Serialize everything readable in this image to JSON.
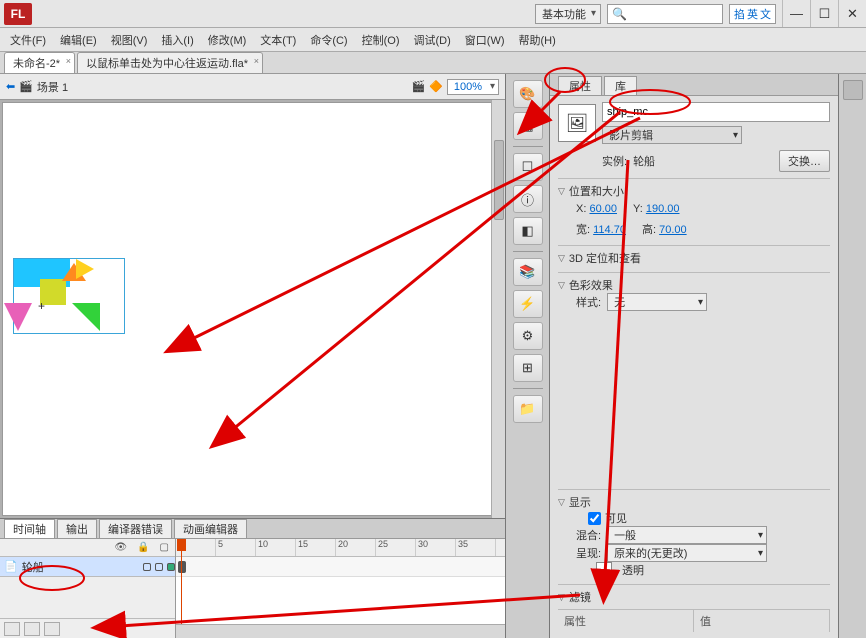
{
  "app": {
    "logo": "FL"
  },
  "workspace_combo": "基本功能",
  "ime": {
    "a": "掐",
    "b": "英",
    "c": "文"
  },
  "menus": [
    "文件(F)",
    "编辑(E)",
    "视图(V)",
    "插入(I)",
    "修改(M)",
    "文本(T)",
    "命令(C)",
    "控制(O)",
    "调试(D)",
    "窗口(W)",
    "帮助(H)"
  ],
  "doctabs": [
    {
      "label": "未命名-2*",
      "active": true
    },
    {
      "label": "以鼠标单击处为中心往返运动.fla*",
      "active": false
    }
  ],
  "stage": {
    "scene_label": "场景 1",
    "zoom": "100%"
  },
  "timeline": {
    "tabs": [
      "时间轴",
      "输出",
      "编译器错误",
      "动画编辑器"
    ],
    "active_tab": 0,
    "layer_name": "轮船",
    "ruler": [
      "1",
      "5",
      "10",
      "15",
      "20",
      "25",
      "30",
      "35"
    ]
  },
  "panel": {
    "tabs": [
      "属性",
      "库"
    ],
    "active_tab": 0,
    "instance_name": "ship_mc",
    "type": "影片剪辑",
    "instance_label": "实例:",
    "instance_of": "轮船",
    "swap": "交换…",
    "sections": {
      "pos": {
        "title": "位置和大小",
        "x_label": "X:",
        "x": "60.00",
        "y_label": "Y:",
        "y": "190.00",
        "w_label": "宽:",
        "w": "114.70",
        "h_label": "高:",
        "h": "70.00"
      },
      "d3": {
        "title": "3D 定位和查看"
      },
      "color": {
        "title": "色彩效果",
        "style_label": "样式:",
        "style": "无"
      },
      "display": {
        "title": "显示",
        "visible": "可见",
        "blend_label": "混合:",
        "blend": "一般",
        "render_label": "呈现:",
        "render": "原来的(无更改)",
        "transparent": "透明"
      },
      "filter": {
        "title": "滤镜",
        "col1": "属性",
        "col2": "值"
      }
    }
  }
}
